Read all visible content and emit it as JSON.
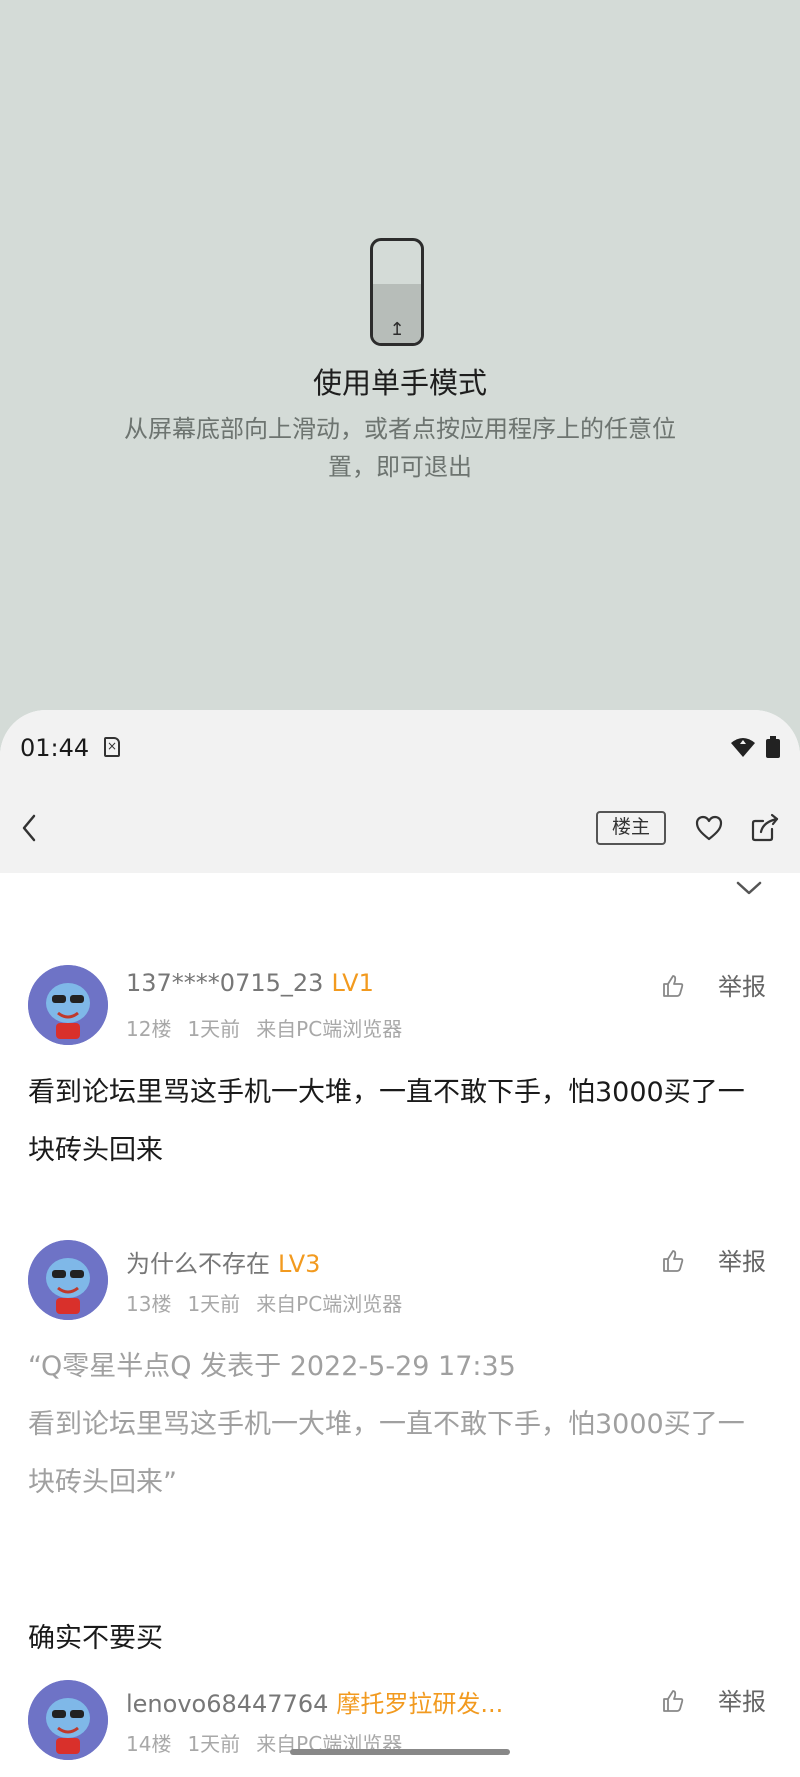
{
  "one_hand_mode": {
    "icon": "phone-swipe-up-icon",
    "title": "使用单手模式",
    "description": "从屏幕底部向上滑动，或者点按应用程序上的任意位置，即可退出"
  },
  "status_bar": {
    "time": "01:44",
    "sim_icon": "sim-card-icon",
    "wifi_icon": "wifi-icon",
    "battery_icon": "battery-icon"
  },
  "app_bar": {
    "back_icon": "back-arrow-icon",
    "louzhu_label": "楼主",
    "favorite_icon": "heart-icon",
    "share_icon": "share-icon",
    "collapse_icon": "chevron-down-icon"
  },
  "posts": [
    {
      "username": "137****0715_23",
      "level": "LV1",
      "floor": "12楼",
      "time": "1天前",
      "source": "来自PC端浏览器",
      "report_label": "举报",
      "content": "看到论坛里骂这手机一大堆，一直不敢下手，怕3000买了一块砖头回来"
    },
    {
      "username": "为什么不存在",
      "level": "LV3",
      "floor": "13楼",
      "time": "1天前",
      "source": "来自PC端浏览器",
      "report_label": "举报",
      "quote_header": "“Q零星半点Q 发表于 2022-5-29 17:35",
      "quote_body": "看到论坛里骂这手机一大堆，一直不敢下手，怕3000买了一块砖头回来”",
      "content": "确实不要买"
    },
    {
      "username": "lenovo68447764",
      "level": "摩托罗拉研发...",
      "floor": "14楼",
      "time": "1天前",
      "source": "来自PC端浏览器",
      "report_label": "举报"
    }
  ],
  "colors": {
    "overlay_bg": "#d4dbd7",
    "level_accent": "#f29a1f",
    "meta_gray": "#a8a8a8"
  }
}
